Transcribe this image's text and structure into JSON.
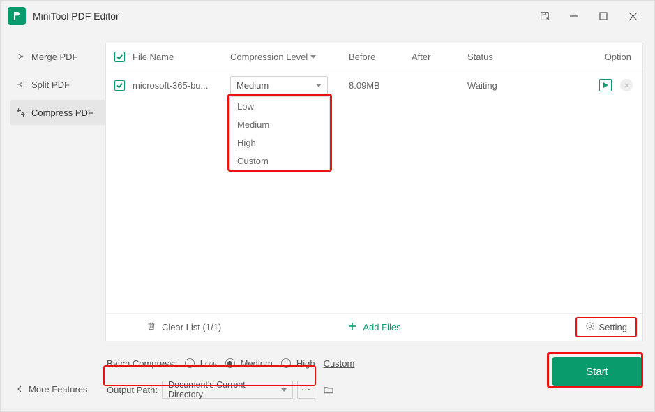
{
  "app": {
    "title": "MiniTool PDF Editor"
  },
  "sidebar": {
    "items": [
      {
        "label": "Merge PDF"
      },
      {
        "label": "Split PDF"
      },
      {
        "label": "Compress PDF"
      }
    ],
    "more": "More Features"
  },
  "table": {
    "headers": {
      "filename": "File Name",
      "level": "Compression Level",
      "before": "Before",
      "after": "After",
      "status": "Status",
      "option": "Option"
    },
    "rows": [
      {
        "filename": "microsoft-365-bu...",
        "level": "Medium",
        "before": "8.09MB",
        "after": "",
        "status": "Waiting"
      }
    ],
    "dropdown": [
      "Low",
      "Medium",
      "High",
      "Custom"
    ],
    "footer": {
      "clear": "Clear List (1/1)",
      "add": "Add Files",
      "setting": "Setting"
    }
  },
  "batch": {
    "label": "Batch Compress:",
    "options": {
      "low": "Low",
      "medium": "Medium",
      "high": "High",
      "custom": "Custom"
    }
  },
  "output": {
    "label": "Output Path:",
    "value": "Document's Current Directory",
    "dots": "⋯"
  },
  "start": "Start"
}
